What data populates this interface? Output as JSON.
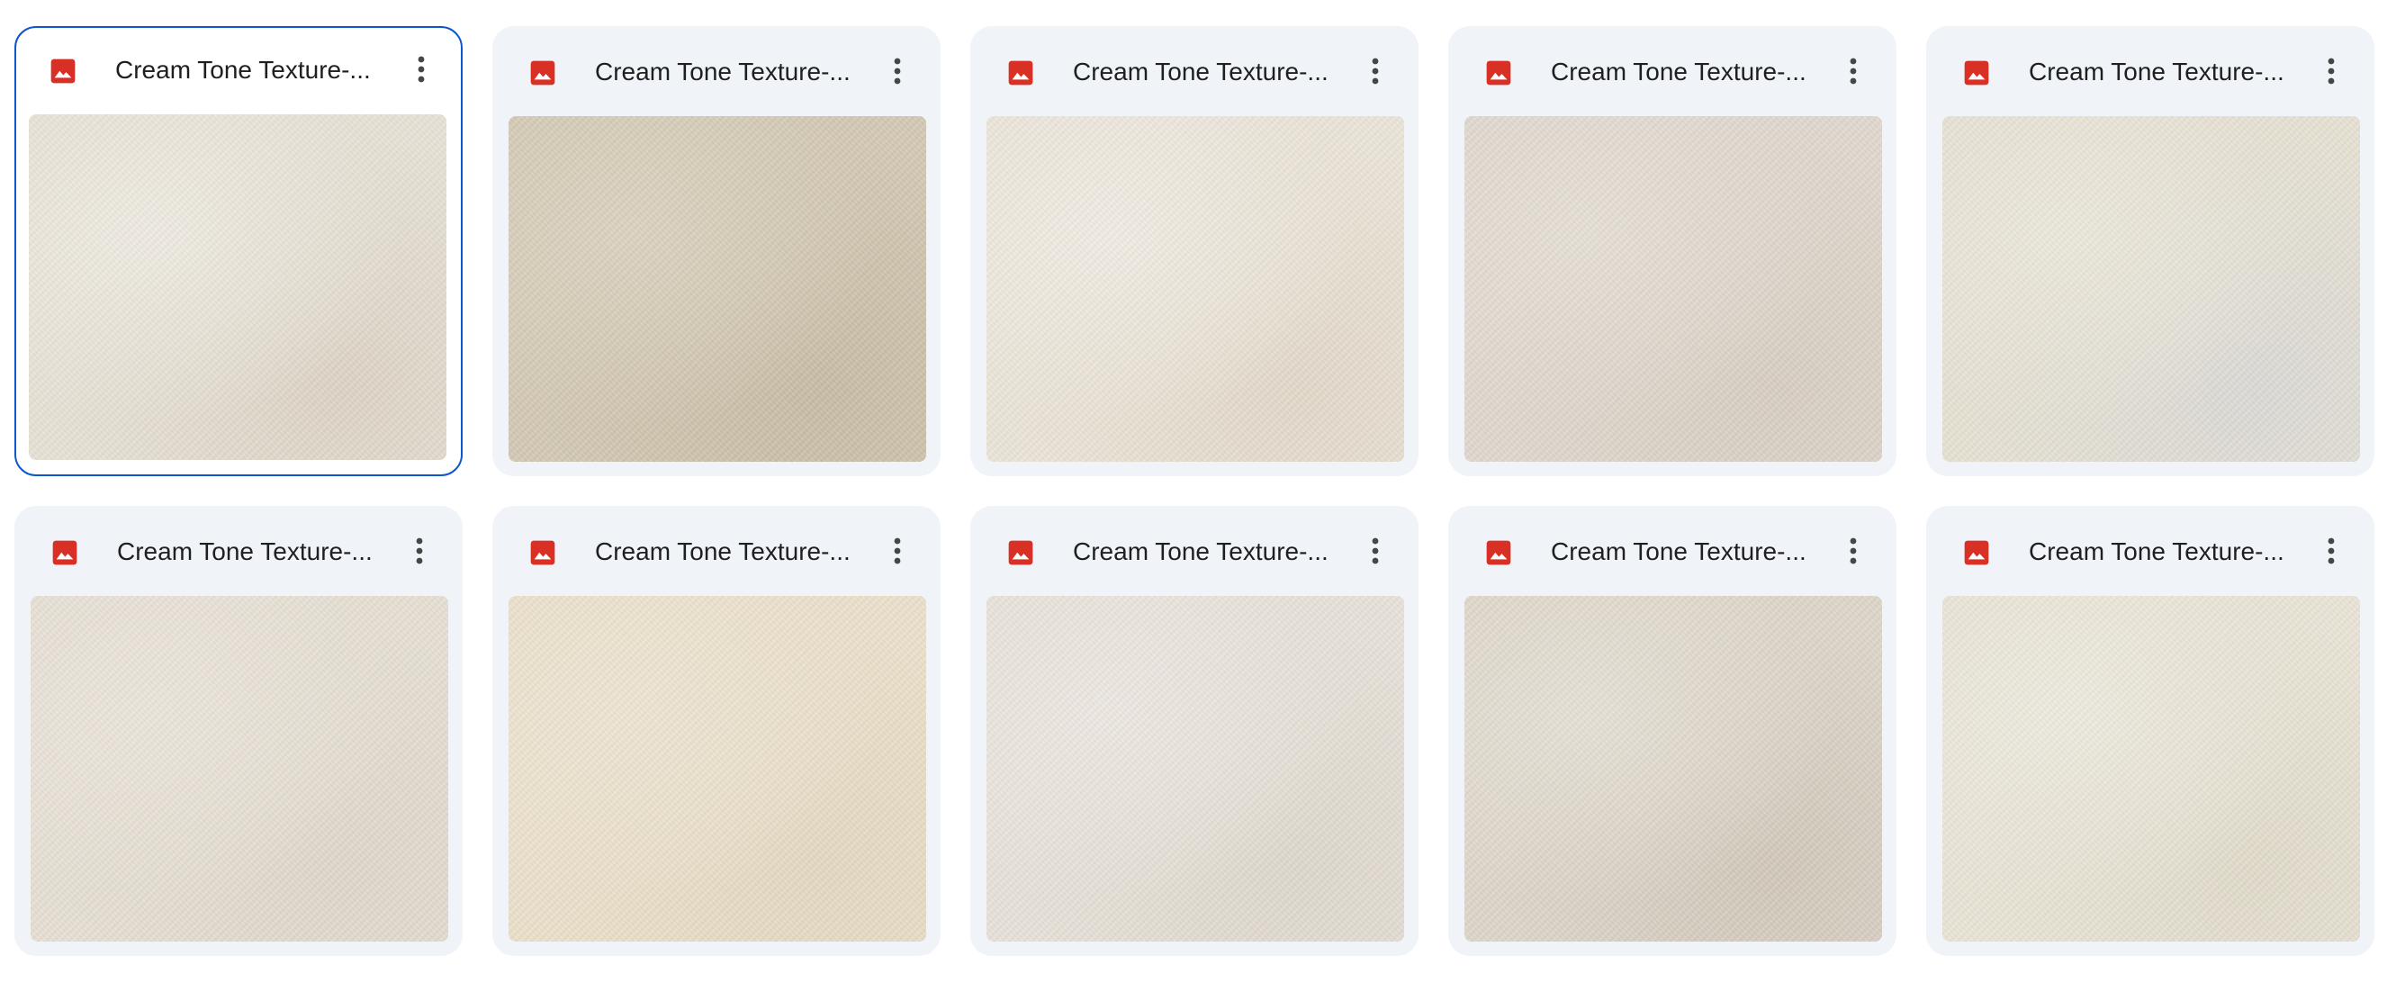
{
  "files": [
    {
      "title": "Cream Tone Texture-...",
      "icon": "image-file-icon",
      "selected": true,
      "thumb": {
        "base": "#e7e1d6",
        "light": "#efebe2",
        "dark": "#ddd4c6"
      }
    },
    {
      "title": "Cream Tone Texture-...",
      "icon": "image-file-icon",
      "selected": false,
      "thumb": {
        "base": "#d3c9b4",
        "light": "#dcd3c0",
        "dark": "#c8bda6"
      }
    },
    {
      "title": "Cream Tone Texture-...",
      "icon": "image-file-icon",
      "selected": false,
      "thumb": {
        "base": "#ebe4d8",
        "light": "#f1ece3",
        "dark": "#e2d9ca"
      }
    },
    {
      "title": "Cream Tone Texture-...",
      "icon": "image-file-icon",
      "selected": false,
      "thumb": {
        "base": "#e0d8ce",
        "light": "#e6dfd6",
        "dark": "#d8cfc3"
      }
    },
    {
      "title": "Cream Tone Texture-...",
      "icon": "image-file-icon",
      "selected": false,
      "thumb": {
        "base": "#e6e1d3",
        "light": "#ece8dc",
        "dark": "#dcdad6"
      }
    },
    {
      "title": "Cream Tone Texture-...",
      "icon": "image-file-icon",
      "selected": false,
      "thumb": {
        "base": "#e6dfd4",
        "light": "#ebe5db",
        "dark": "#dfd7cb"
      }
    },
    {
      "title": "Cream Tone Texture-...",
      "icon": "image-file-icon",
      "selected": false,
      "thumb": {
        "base": "#ebe0cb",
        "light": "#eee5d3",
        "dark": "#e4d9c2"
      }
    },
    {
      "title": "Cream Tone Texture-...",
      "icon": "image-file-icon",
      "selected": false,
      "thumb": {
        "base": "#e7e1d9",
        "light": "#ede8e1",
        "dark": "#ded8ce"
      }
    },
    {
      "title": "Cream Tone Texture-...",
      "icon": "image-file-icon",
      "selected": false,
      "thumb": {
        "base": "#ddd6ca",
        "light": "#e6e0d6",
        "dark": "#d2c9bb"
      }
    },
    {
      "title": "Cream Tone Texture-...",
      "icon": "image-file-icon",
      "selected": false,
      "thumb": {
        "base": "#e9e4d6",
        "light": "#eeeadf",
        "dark": "#e1dbcb"
      }
    }
  ],
  "colors": {
    "card_bg": "#f0f4f9",
    "selected_border": "#0b57d0",
    "image_icon": "#d93025",
    "more_icon": "#444746",
    "title_text": "#1f1f1f"
  }
}
